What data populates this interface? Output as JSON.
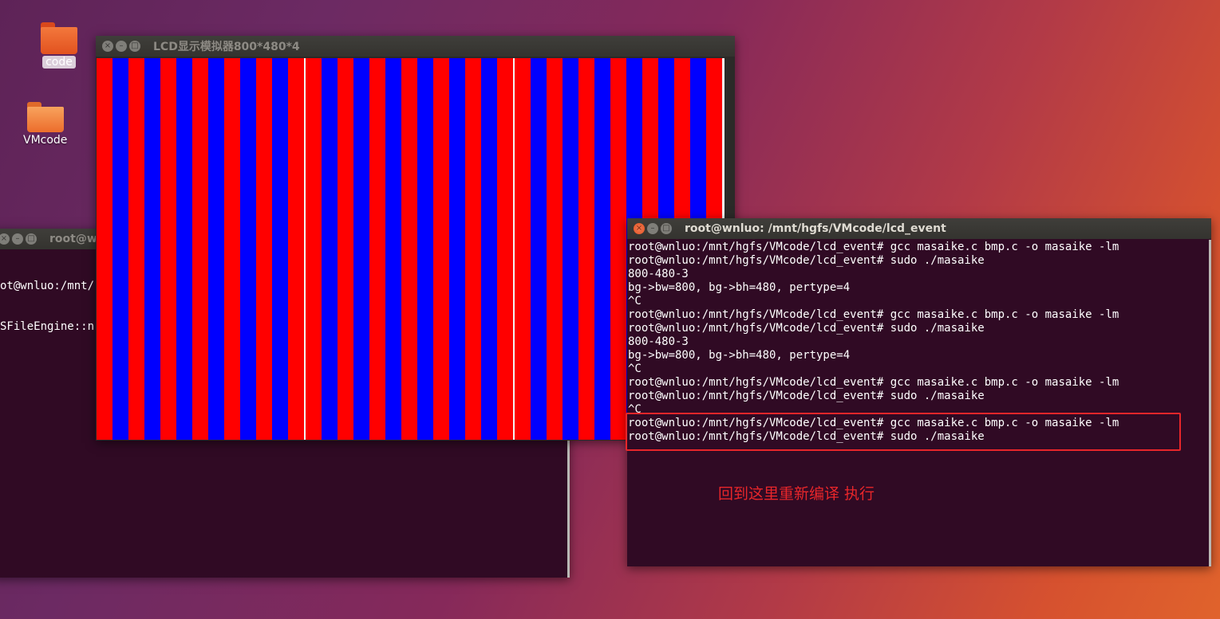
{
  "desktop": {
    "icons": [
      {
        "label": "code",
        "icon": "folder-icon",
        "color": "#ea5a28",
        "selected": true
      },
      {
        "label": "VMcode",
        "icon": "folder-icon",
        "color": "#f0742e",
        "selected": false
      }
    ]
  },
  "left_terminal": {
    "title": "root@wn",
    "lines": [
      "ot@wnluo:/mnt/",
      "SFileEngine::n"
    ]
  },
  "lcd_window": {
    "title": "LCD显示模拟器800*480*4",
    "colors": {
      "red": "#ff0000",
      "blue": "#0000ff"
    },
    "stripe_pattern": "alternating-red-blue-vertical"
  },
  "right_terminal": {
    "title": "root@wnluo: /mnt/hgfs/VMcode/lcd_event",
    "lines": [
      "root@wnluo:/mnt/hgfs/VMcode/lcd_event# gcc masaike.c bmp.c -o masaike -lm",
      "root@wnluo:/mnt/hgfs/VMcode/lcd_event# sudo ./masaike",
      "800-480-3",
      "bg->bw=800, bg->bh=480, pertype=4",
      "^C",
      "root@wnluo:/mnt/hgfs/VMcode/lcd_event# gcc masaike.c bmp.c -o masaike -lm",
      "root@wnluo:/mnt/hgfs/VMcode/lcd_event# sudo ./masaike",
      "800-480-3",
      "bg->bw=800, bg->bh=480, pertype=4",
      "^C",
      "root@wnluo:/mnt/hgfs/VMcode/lcd_event# gcc masaike.c bmp.c -o masaike -lm",
      "root@wnluo:/mnt/hgfs/VMcode/lcd_event# sudo ./masaike",
      "^C",
      "root@wnluo:/mnt/hgfs/VMcode/lcd_event# gcc masaike.c bmp.c -o masaike -lm",
      "root@wnluo:/mnt/hgfs/VMcode/lcd_event# sudo ./masaike"
    ]
  },
  "annotation": {
    "text": "回到这里重新编译 执行",
    "color": "#e8262a"
  },
  "window_buttons": {
    "close": "×",
    "minimize": "–",
    "maximize": "□"
  }
}
